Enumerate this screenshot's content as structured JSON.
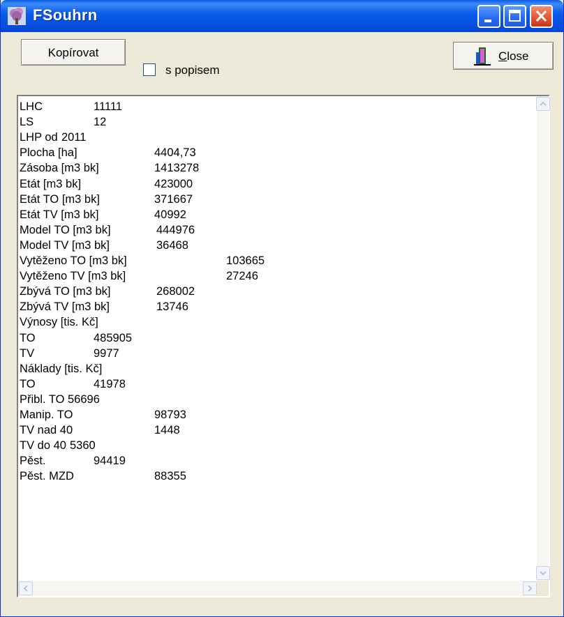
{
  "window": {
    "title": "FSouhrn"
  },
  "toolbar": {
    "copy_label": "Kopírovat",
    "checkbox_label": "s popisem",
    "checkbox_checked": false,
    "close_label_prefix": "",
    "close_label_ul": "C",
    "close_label_rest": "lose"
  },
  "summary": {
    "rows": [
      {
        "label": "LHC",
        "value": "11111",
        "col": 1
      },
      {
        "label": "LS",
        "value": "12",
        "col": 1
      },
      {
        "label": "LHP od",
        "value": "2011",
        "col": 0
      },
      {
        "label": "Plocha [ha]",
        "value": "4404,73",
        "col": 2
      },
      {
        "label": "Zásoba [m3 bk]",
        "value": "1413278",
        "col": 2
      },
      {
        "label": "Etát [m3 bk]",
        "value": "423000",
        "col": 2
      },
      {
        "label": "Etát TO [m3 bk]",
        "value": "371667",
        "col": 2
      },
      {
        "label": "Etát TV [m3 bk]",
        "value": "40992",
        "col": 2
      },
      {
        "label": "Model TO [m3 bk]",
        "value": "444976",
        "col": 3
      },
      {
        "label": "Model TV [m3 bk]",
        "value": "36468",
        "col": 3
      },
      {
        "label": "Vytěženo TO [m3 bk]",
        "value": "103665",
        "col": 4
      },
      {
        "label": "Vytěženo TV [m3 bk]",
        "value": "27246",
        "col": 4
      },
      {
        "label": "Zbývá TO [m3 bk]",
        "value": "268002",
        "col": 3
      },
      {
        "label": "Zbývá TV [m3 bk]",
        "value": "13746",
        "col": 3
      },
      {
        "label": "Výnosy [tis. Kč]",
        "value": "",
        "col": 0
      },
      {
        "label": "TO",
        "value": "485905",
        "col": 1
      },
      {
        "label": "TV",
        "value": "9977",
        "col": 1
      },
      {
        "label": "Náklady [tis. Kč]",
        "value": "",
        "col": 0
      },
      {
        "label": "TO",
        "value": "41978",
        "col": 1
      },
      {
        "label": "Přibl. TO",
        "value": "56696",
        "col": 0
      },
      {
        "label": "Manip. TO",
        "value": "98793",
        "col": 2
      },
      {
        "label": "TV nad 40",
        "value": "1448",
        "col": 2
      },
      {
        "label": "TV do 40",
        "value": "5360",
        "col": 0
      },
      {
        "label": "Pěst.",
        "value": "94419",
        "col": 1
      },
      {
        "label": "Pěst. MZD",
        "value": "88355",
        "col": 2
      }
    ]
  },
  "colors": {
    "titlebar": "#0A5BE8",
    "face": "#ECE9D8",
    "close": "#E2593A"
  },
  "icons": {
    "app": "tree-icon",
    "close_button": "door-exit-icon"
  }
}
